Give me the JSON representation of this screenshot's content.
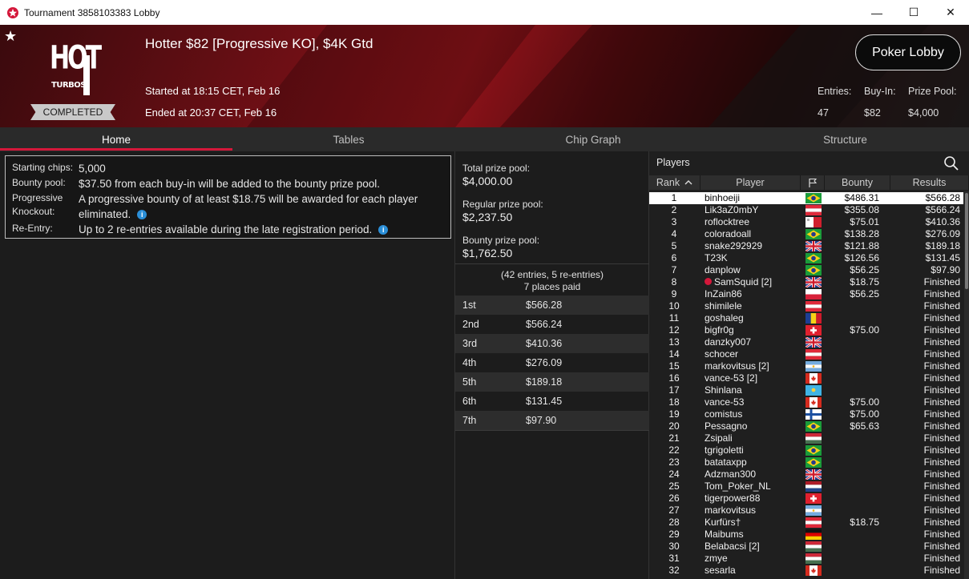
{
  "window": {
    "title": "Tournament 3858103383 Lobby",
    "minimize": "—",
    "maximize": "☐",
    "close": "✕"
  },
  "header": {
    "logo_top": "HOT",
    "logo_bottom": "TURBOS",
    "status": "COMPLETED",
    "name": "Hotter $82 [Progressive KO], $4K Gtd",
    "started": "Started at 18:15 CET, Feb 16",
    "ended": "Ended at 20:37 CET, Feb 16",
    "lobby_button": "Poker Lobby",
    "entries_label": "Entries:",
    "entries_value": "47",
    "buyin_label": "Buy-In:",
    "buyin_value": "$82",
    "prize_label": "Prize Pool:",
    "prize_value": "$4,000"
  },
  "tabs": [
    "Home",
    "Tables",
    "Chip Graph",
    "Structure"
  ],
  "info": {
    "starting_label": "Starting chips:",
    "starting_value": "5,000",
    "bountypool_label": "Bounty pool:",
    "bountypool_value": "$37.50 from each buy-in will be added to the bounty prize pool.",
    "progressive_label_1": "Progressive",
    "progressive_label_2": "Knockout:",
    "progressive_value_1": "A progressive bounty of at least $18.75 will be awarded for each player",
    "progressive_value_2": "eliminated.",
    "reentry_label": "Re-Entry:",
    "reentry_value": "Up to 2 re-entries available during the late registration period."
  },
  "prize": {
    "total_label": "Total prize pool:",
    "total_value": "$4,000.00",
    "regular_label": "Regular prize pool:",
    "regular_value": "$2,237.50",
    "bounty_label": "Bounty prize pool:",
    "bounty_value": "$1,762.50",
    "entries_note": "(42 entries, 5 re-entries)",
    "places_note": "7 places paid",
    "payouts": [
      {
        "place": "1st",
        "amount": "$566.28"
      },
      {
        "place": "2nd",
        "amount": "$566.24"
      },
      {
        "place": "3rd",
        "amount": "$410.36"
      },
      {
        "place": "4th",
        "amount": "$276.09"
      },
      {
        "place": "5th",
        "amount": "$189.18"
      },
      {
        "place": "6th",
        "amount": "$131.45"
      },
      {
        "place": "7th",
        "amount": "$97.90"
      }
    ]
  },
  "players": {
    "title": "Players",
    "col_rank": "Rank",
    "col_player": "Player",
    "col_bounty": "Bounty",
    "col_results": "Results",
    "rows": [
      {
        "rank": "1",
        "name": "binhoeiji",
        "flag": "brazil-flag",
        "bounty": "$486.31",
        "result": "$566.28"
      },
      {
        "rank": "2",
        "name": "Lik3aZ0mbY",
        "flag": "austria-flag",
        "bounty": "$355.08",
        "result": "$566.24"
      },
      {
        "rank": "3",
        "name": "roflocktree",
        "flag": "malta-flag",
        "bounty": "$75.01",
        "result": "$410.36"
      },
      {
        "rank": "4",
        "name": "coloradoall",
        "flag": "brazil-flag",
        "bounty": "$138.28",
        "result": "$276.09"
      },
      {
        "rank": "5",
        "name": "snake292929",
        "flag": "uk-flag",
        "bounty": "$121.88",
        "result": "$189.18"
      },
      {
        "rank": "6",
        "name": "T23K",
        "flag": "brazil-flag",
        "bounty": "$126.56",
        "result": "$131.45"
      },
      {
        "rank": "7",
        "name": "danplow",
        "flag": "brazil-flag",
        "bounty": "$56.25",
        "result": "$97.90"
      },
      {
        "rank": "8",
        "name": "SamSquid [2]",
        "flag": "uk-flag",
        "bounty": "$18.75",
        "result": "Finished",
        "star": true
      },
      {
        "rank": "9",
        "name": "InZain86",
        "flag": "poland-flag",
        "bounty": "$56.25",
        "result": "Finished"
      },
      {
        "rank": "10",
        "name": "shimilele",
        "flag": "austria-flag",
        "bounty": "",
        "result": "Finished"
      },
      {
        "rank": "11",
        "name": "goshaleg",
        "flag": "romania-flag",
        "bounty": "",
        "result": "Finished"
      },
      {
        "rank": "12",
        "name": "bigfr0g",
        "flag": "switzerland-flag",
        "bounty": "$75.00",
        "result": "Finished"
      },
      {
        "rank": "13",
        "name": "danzky007",
        "flag": "uk-flag",
        "bounty": "",
        "result": "Finished"
      },
      {
        "rank": "14",
        "name": "schocer",
        "flag": "austria-flag",
        "bounty": "",
        "result": "Finished"
      },
      {
        "rank": "15",
        "name": "markovitsus [2]",
        "flag": "argentina-flag",
        "bounty": "",
        "result": "Finished"
      },
      {
        "rank": "16",
        "name": "vance-53 [2]",
        "flag": "canada-flag",
        "bounty": "",
        "result": "Finished"
      },
      {
        "rank": "17",
        "name": "Shinlana",
        "flag": "kazakhstan-flag",
        "bounty": "",
        "result": "Finished"
      },
      {
        "rank": "18",
        "name": "vance-53",
        "flag": "canada-flag",
        "bounty": "$75.00",
        "result": "Finished"
      },
      {
        "rank": "19",
        "name": "comistus",
        "flag": "finland-flag",
        "bounty": "$75.00",
        "result": "Finished"
      },
      {
        "rank": "20",
        "name": "Pessagno",
        "flag": "brazil-flag",
        "bounty": "$65.63",
        "result": "Finished"
      },
      {
        "rank": "21",
        "name": "Zsipali",
        "flag": "hungary-flag",
        "bounty": "",
        "result": "Finished"
      },
      {
        "rank": "22",
        "name": "tgrigoletti",
        "flag": "brazil-flag",
        "bounty": "",
        "result": "Finished"
      },
      {
        "rank": "23",
        "name": "batataxpp",
        "flag": "brazil-flag",
        "bounty": "",
        "result": "Finished"
      },
      {
        "rank": "24",
        "name": "Adzman300",
        "flag": "uk-flag",
        "bounty": "",
        "result": "Finished"
      },
      {
        "rank": "25",
        "name": "Tom_Poker_NL",
        "flag": "netherlands-flag",
        "bounty": "",
        "result": "Finished"
      },
      {
        "rank": "26",
        "name": "tigerpower88",
        "flag": "switzerland-flag",
        "bounty": "",
        "result": "Finished"
      },
      {
        "rank": "27",
        "name": "markovitsus",
        "flag": "argentina-flag",
        "bounty": "",
        "result": "Finished"
      },
      {
        "rank": "28",
        "name": "Kurfürs†",
        "flag": "austria-flag",
        "bounty": "$18.75",
        "result": "Finished"
      },
      {
        "rank": "29",
        "name": "Maibums",
        "flag": "germany-flag",
        "bounty": "",
        "result": "Finished"
      },
      {
        "rank": "30",
        "name": "Belabacsi [2]",
        "flag": "hungary-flag",
        "bounty": "",
        "result": "Finished"
      },
      {
        "rank": "31",
        "name": "zmye",
        "flag": "hungary-flag",
        "bounty": "",
        "result": "Finished"
      },
      {
        "rank": "32",
        "name": "sesarla",
        "flag": "canada-flag",
        "bounty": "",
        "result": "Finished"
      }
    ]
  }
}
